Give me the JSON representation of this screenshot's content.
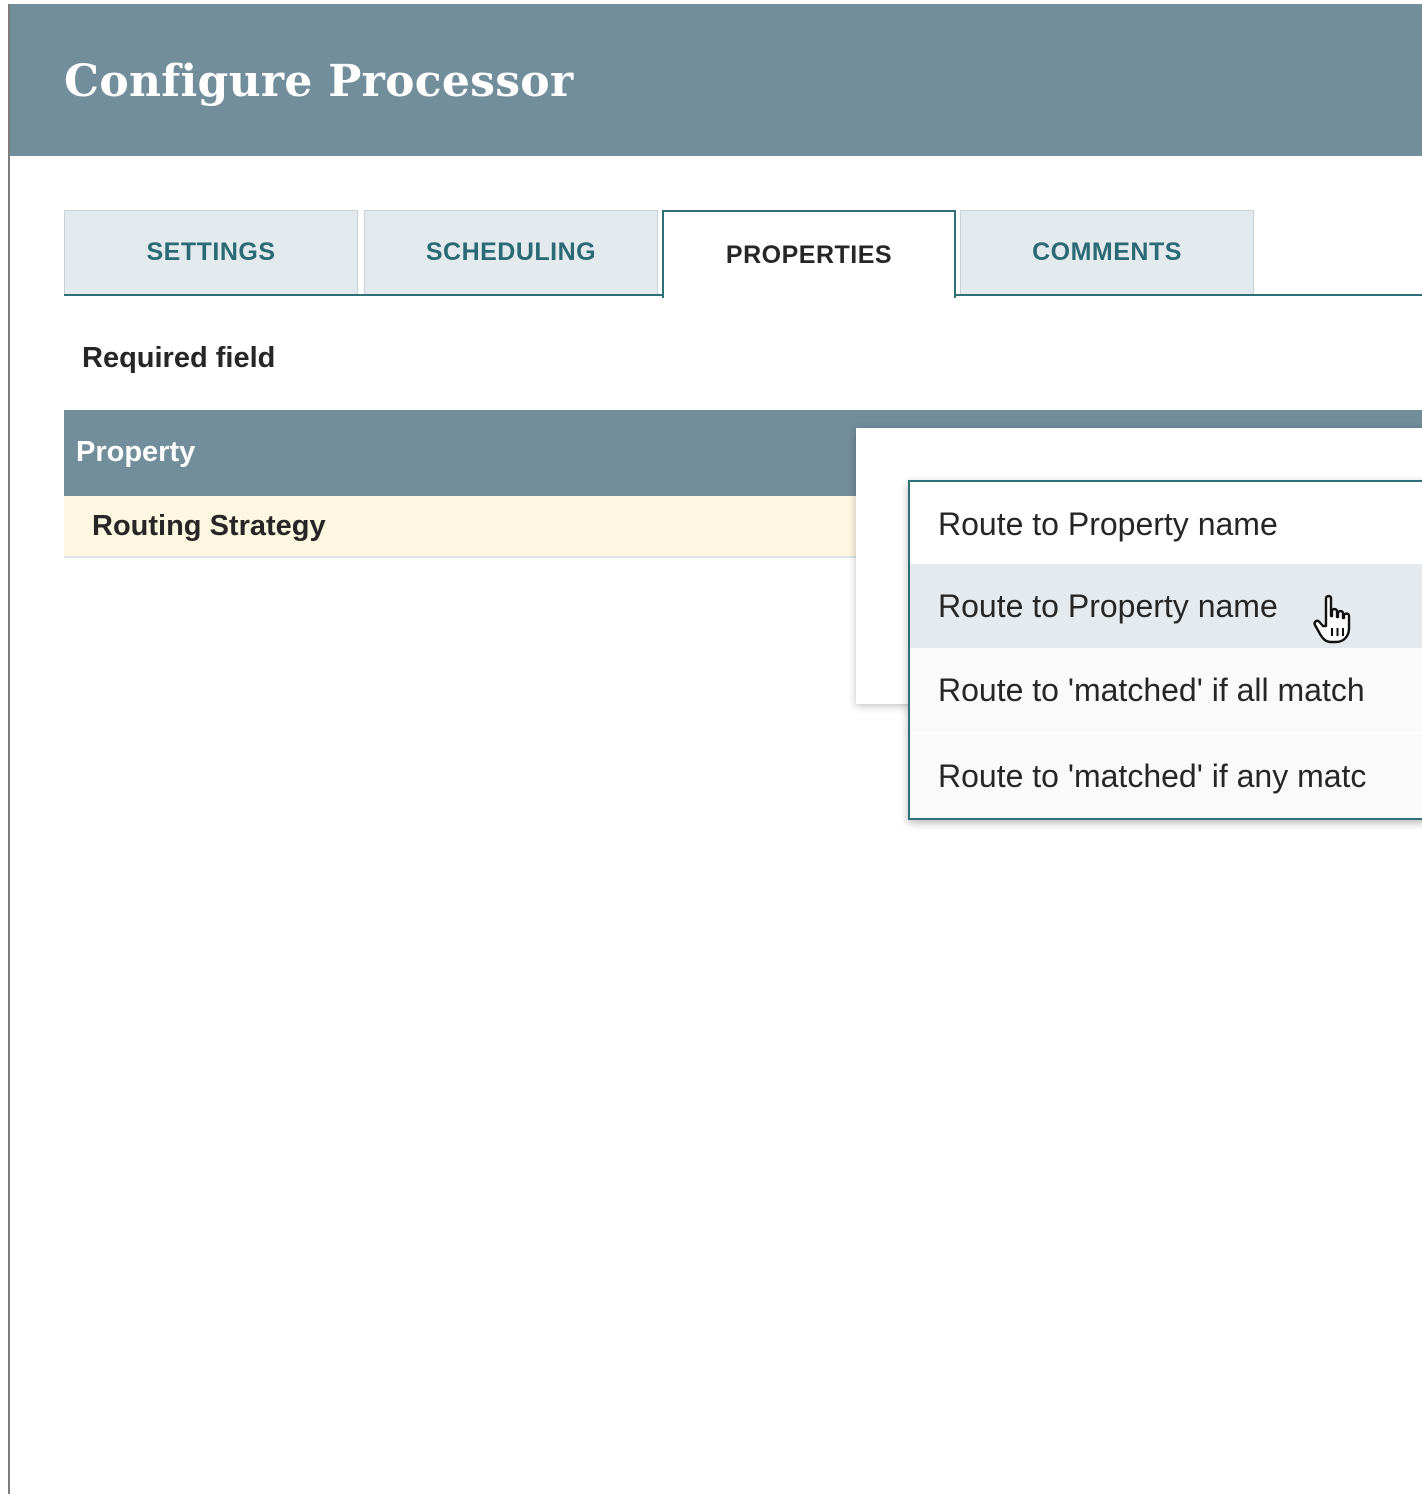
{
  "dialog": {
    "title": "Configure Processor"
  },
  "tabs": [
    {
      "label": "SETTINGS",
      "active": false
    },
    {
      "label": "SCHEDULING",
      "active": false
    },
    {
      "label": "PROPERTIES",
      "active": true
    },
    {
      "label": "COMMENTS",
      "active": false
    }
  ],
  "properties": {
    "required_label": "Required field",
    "table": {
      "column_header": "Property",
      "rows": [
        {
          "name": "Routing Strategy"
        }
      ]
    },
    "dropdown": {
      "options": [
        {
          "label": "Route to Property name",
          "hovered": false
        },
        {
          "label": "Route to Property name",
          "hovered": true
        },
        {
          "label": "Route to 'matched' if all match",
          "hovered": false
        },
        {
          "label": "Route to 'matched' if any matc",
          "hovered": false
        }
      ]
    }
  },
  "colors": {
    "header_bg": "#728e9b",
    "accent": "#2f6f78",
    "row_highlight": "#fdf7e1",
    "option_hover": "#e4eaed"
  },
  "icons": {
    "cursor": "hand-pointer-icon"
  }
}
